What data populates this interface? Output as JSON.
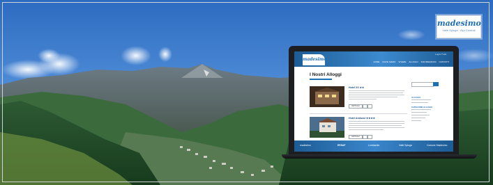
{
  "logo": {
    "brand": "madesimo",
    "tagline": "Valle Spluga · Alpi Centrali"
  },
  "website": {
    "logo_text": "madesimo",
    "utility_links": [
      "Login",
      "IT",
      "EN"
    ],
    "nav_items": [
      "HOME",
      "DOVE SIAMO",
      "VIVERE",
      "ALLOGGI",
      "INFORMAZIONI",
      "CONTATTI"
    ],
    "page_title": "I Nostri Alloggi",
    "listings": [
      {
        "name": "Hotel XX ★★",
        "button": "DETTAGLI"
      },
      {
        "name": "Hotel Andossi ★★★★",
        "button": "DETTAGLI"
      }
    ],
    "sidebar": {
      "section_1": "ALLOGGI",
      "section_2": "CATEGORIE ALLOGGI"
    },
    "footer": [
      "madesimo",
      "ERSAF",
      "Lombardia",
      "Valle Spluga",
      "Comune Madesimo"
    ]
  },
  "colors": {
    "brand_blue": "#1d6fb8",
    "sky": "#3f78c7",
    "forest": "#1f4a27"
  }
}
